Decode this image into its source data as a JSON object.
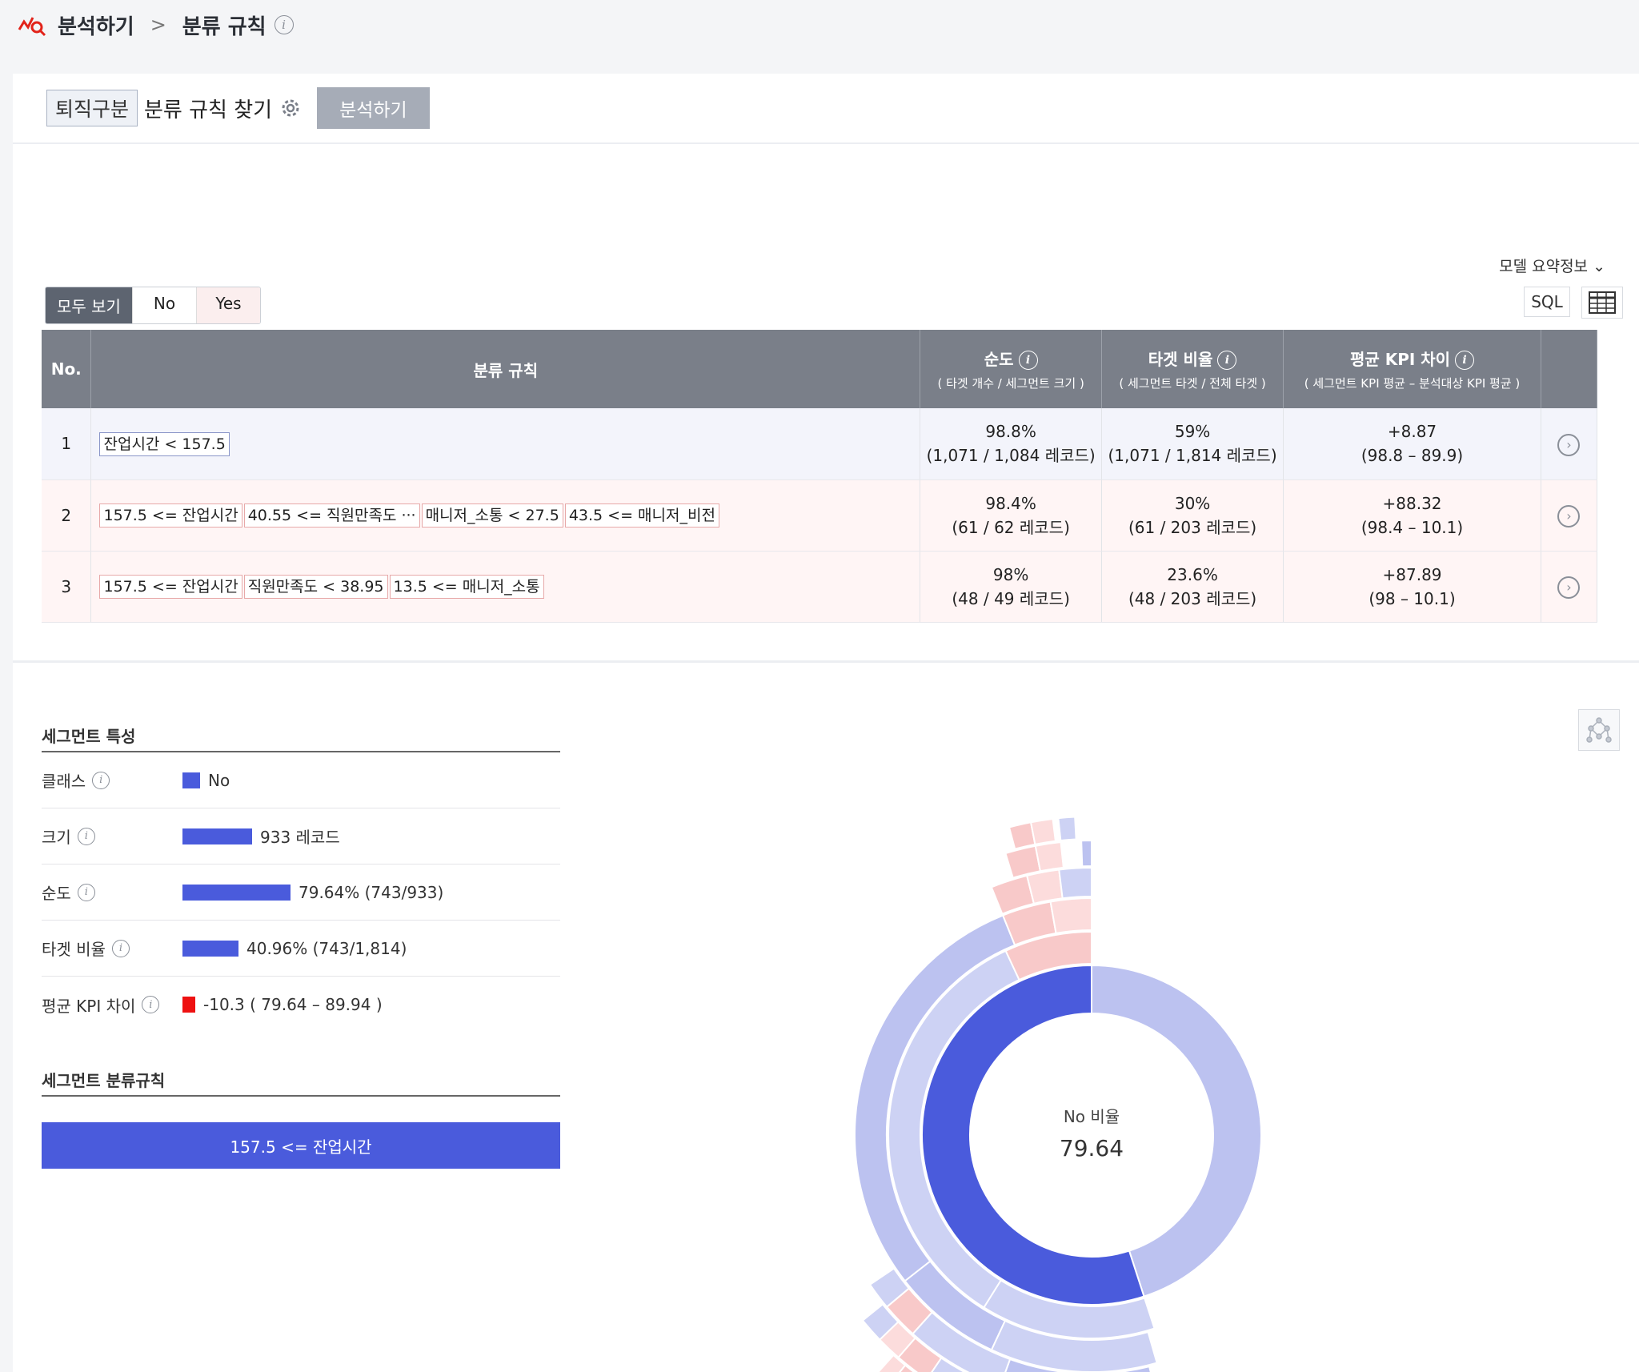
{
  "breadcrumb": {
    "root": "분석하기",
    "current": "분류 규칙"
  },
  "header": {
    "tag": "퇴직구분",
    "title": "분류 규칙 찾기",
    "analyze_button": "분석하기"
  },
  "toolbar": {
    "model_summary": "모델 요약정보",
    "filters": {
      "all": "모두 보기",
      "no": "No",
      "yes": "Yes"
    },
    "sql_button": "SQL"
  },
  "table": {
    "headers": {
      "no": "No.",
      "rule": "분류 규칙",
      "purity": "순도",
      "purity_sub": "( 타겟 개수 / 세그먼트 크기 )",
      "target_ratio": "타겟 비율",
      "target_ratio_sub": "( 세그먼트 타겟 / 전체 타겟 )",
      "kpi_diff": "평균 KPI 차이",
      "kpi_diff_sub": "( 세그먼트 KPI 평균 – 분석대상 KPI 평균 )"
    },
    "rows": [
      {
        "no": "1",
        "chips": [
          "잔업시간 < 157.5"
        ],
        "purity": "98.8%",
        "purity_detail": "(1,071 / 1,084 레코드)",
        "target": "59%",
        "target_detail": "(1,071 / 1,814 레코드)",
        "kpi": "+8.87",
        "kpi_detail": "(98.8 – 89.9)"
      },
      {
        "no": "2",
        "chips": [
          "157.5 <= 잔업시간",
          "40.55 <= 직원만족도 ···",
          "매니저_소통 < 27.5",
          "43.5 <= 매니저_비전"
        ],
        "purity": "98.4%",
        "purity_detail": "(61 / 62 레코드)",
        "target": "30%",
        "target_detail": "(61 / 203 레코드)",
        "kpi": "+88.32",
        "kpi_detail": "(98.4 – 10.1)"
      },
      {
        "no": "3",
        "chips": [
          "157.5 <= 잔업시간",
          "직원만족도 < 38.95",
          "13.5 <= 매니저_소통"
        ],
        "purity": "98%",
        "purity_detail": "(48 / 49 레코드)",
        "target": "23.6%",
        "target_detail": "(48 / 203 레코드)",
        "kpi": "+87.89",
        "kpi_detail": "(98 – 10.1)"
      }
    ]
  },
  "segment": {
    "title": "세그먼트 특성",
    "class_label": "클래스",
    "class_value": "No",
    "size_label": "크기",
    "size_value": "933 레코드",
    "size_fraction": 0.51,
    "purity_label": "순도",
    "purity_value": "79.64% (743/933)",
    "purity_fraction": 0.7964,
    "target_label": "타겟 비율",
    "target_value": "40.96% (743/1,814)",
    "target_fraction": 0.4096,
    "kpi_label": "평균 KPI 차이",
    "kpi_value": "-10.3 ( 79.64 – 89.94 )",
    "rules_title": "세그먼트 분류규칙",
    "rule": "157.5 <= 잔업시간"
  },
  "sunburst": {
    "center_label": "No 비율",
    "center_value": "79.64",
    "colors": {
      "dark_blue": "#4a5bdc",
      "light_blue": "#bcc2f0",
      "pale_blue": "#cdd2f4",
      "pink": "#f8c9c9",
      "pale_pink": "#fcdcdc"
    }
  },
  "colors": {
    "accent": "#4a5bdc",
    "header_gray": "#7a7f89",
    "negative": "#ee1111"
  }
}
